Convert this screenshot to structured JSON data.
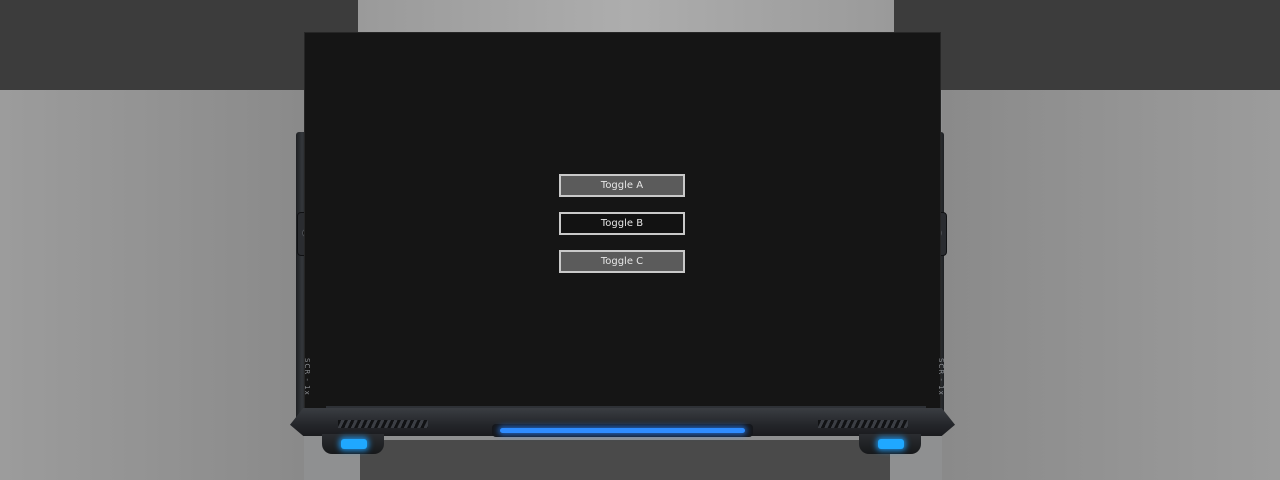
{
  "menu": {
    "buttons": [
      {
        "label": "Toggle A"
      },
      {
        "label": "Toggle B"
      },
      {
        "label": "Toggle C"
      }
    ]
  },
  "device": {
    "side_label_left": "SCR - 1x",
    "side_label_right": "SCR - 1x"
  },
  "colors": {
    "screen_background": "#151515",
    "button_fill": "#5b5b5b",
    "button_fill_selected": "#121212",
    "button_border": "#c9c9c9",
    "accent_light": "#2f8cff"
  }
}
